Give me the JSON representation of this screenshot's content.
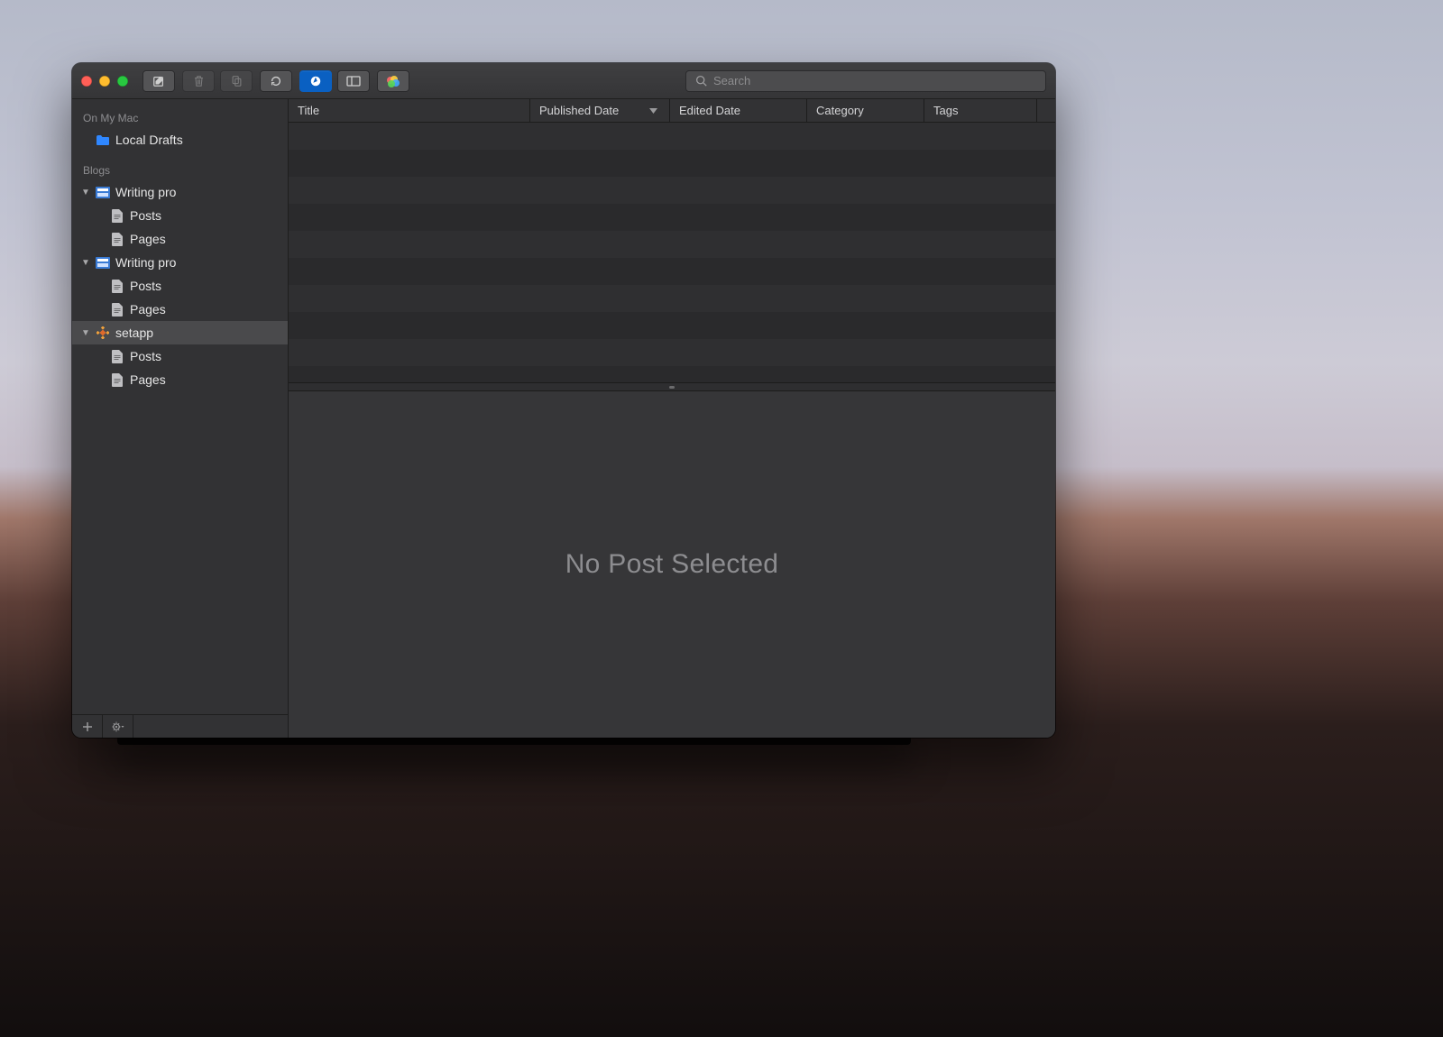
{
  "toolbar": {
    "search_placeholder": "Search",
    "search_value": ""
  },
  "sidebar": {
    "sections": [
      {
        "header": "On My Mac",
        "items": [
          {
            "icon": "folder",
            "label": "Local Drafts"
          }
        ]
      },
      {
        "header": "Blogs",
        "blogs": [
          {
            "icon": "blog",
            "label": "Writing pro",
            "expanded": true,
            "selected": false,
            "children": [
              {
                "icon": "doc",
                "label": "Posts"
              },
              {
                "icon": "doc",
                "label": "Pages"
              }
            ]
          },
          {
            "icon": "blog",
            "label": "Writing pro",
            "expanded": true,
            "selected": false,
            "children": [
              {
                "icon": "doc",
                "label": "Posts"
              },
              {
                "icon": "doc",
                "label": "Pages"
              }
            ]
          },
          {
            "icon": "setapp",
            "label": "setapp",
            "expanded": true,
            "selected": true,
            "children": [
              {
                "icon": "doc",
                "label": "Posts"
              },
              {
                "icon": "doc",
                "label": "Pages"
              }
            ]
          }
        ]
      }
    ]
  },
  "columns": {
    "title": "Title",
    "published": "Published Date",
    "edited": "Edited Date",
    "category": "Category",
    "tags": "Tags"
  },
  "detail": {
    "placeholder": "No Post Selected"
  }
}
